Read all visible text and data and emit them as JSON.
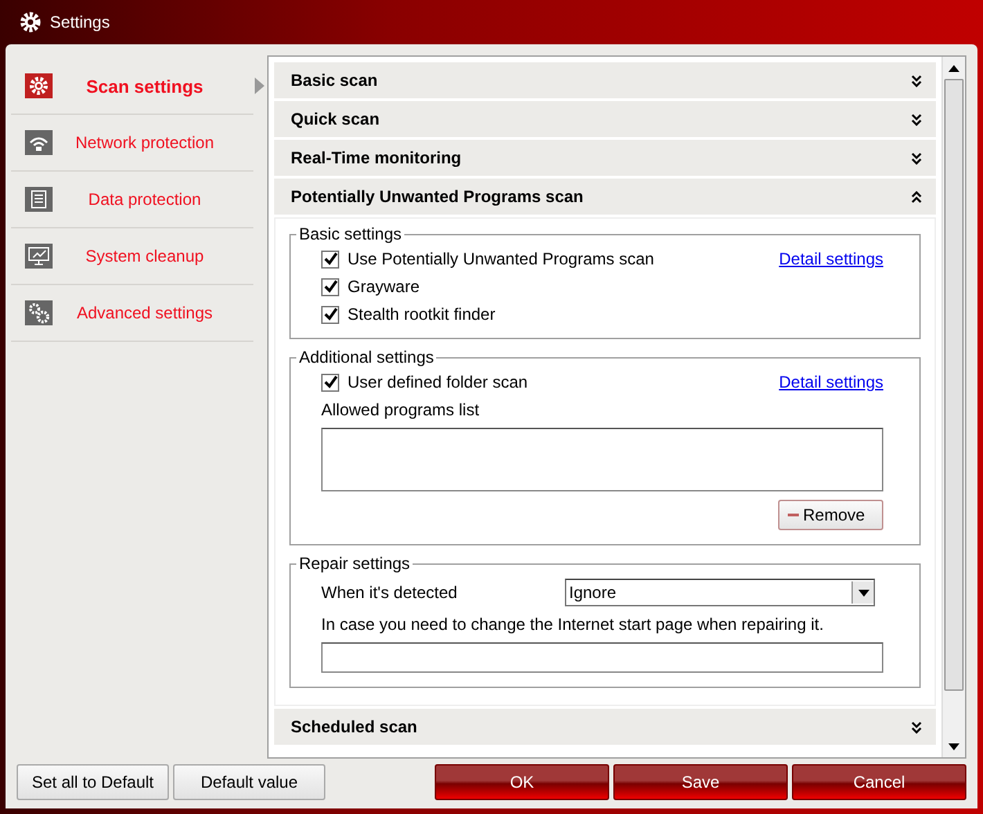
{
  "window": {
    "title": "Settings"
  },
  "sidebar": {
    "items": [
      {
        "label": "Scan settings",
        "selected": true
      },
      {
        "label": "Network protection",
        "selected": false
      },
      {
        "label": "Data protection",
        "selected": false
      },
      {
        "label": "System cleanup",
        "selected": false
      },
      {
        "label": "Advanced settings",
        "selected": false
      }
    ]
  },
  "sections": [
    {
      "title": "Basic scan",
      "expanded": false
    },
    {
      "title": "Quick scan",
      "expanded": false
    },
    {
      "title": "Real-Time monitoring",
      "expanded": false
    },
    {
      "title": "Potentially Unwanted Programs scan",
      "expanded": true
    },
    {
      "title": "Scheduled scan",
      "expanded": false
    }
  ],
  "pup": {
    "basic_settings": {
      "legend": "Basic settings",
      "link": "Detail settings",
      "options": [
        {
          "label": "Use Potentially Unwanted Programs scan",
          "checked": true
        },
        {
          "label": "Grayware",
          "checked": true
        },
        {
          "label": "Stealth rootkit finder",
          "checked": true
        }
      ]
    },
    "additional_settings": {
      "legend": "Additional settings",
      "link": "Detail settings",
      "option": {
        "label": "User defined folder scan",
        "checked": true
      },
      "list_label": "Allowed programs list",
      "remove_button": "Remove"
    },
    "repair_settings": {
      "legend": "Repair settings",
      "detected_label": "When it's detected",
      "detected_value": "Ignore",
      "start_page_label": "In case you need to change the Internet start page when repairing it."
    }
  },
  "footer": {
    "left_buttons": [
      "Set all to Default",
      "Default value"
    ],
    "right_buttons": [
      "OK",
      "Save",
      "Cancel"
    ]
  }
}
